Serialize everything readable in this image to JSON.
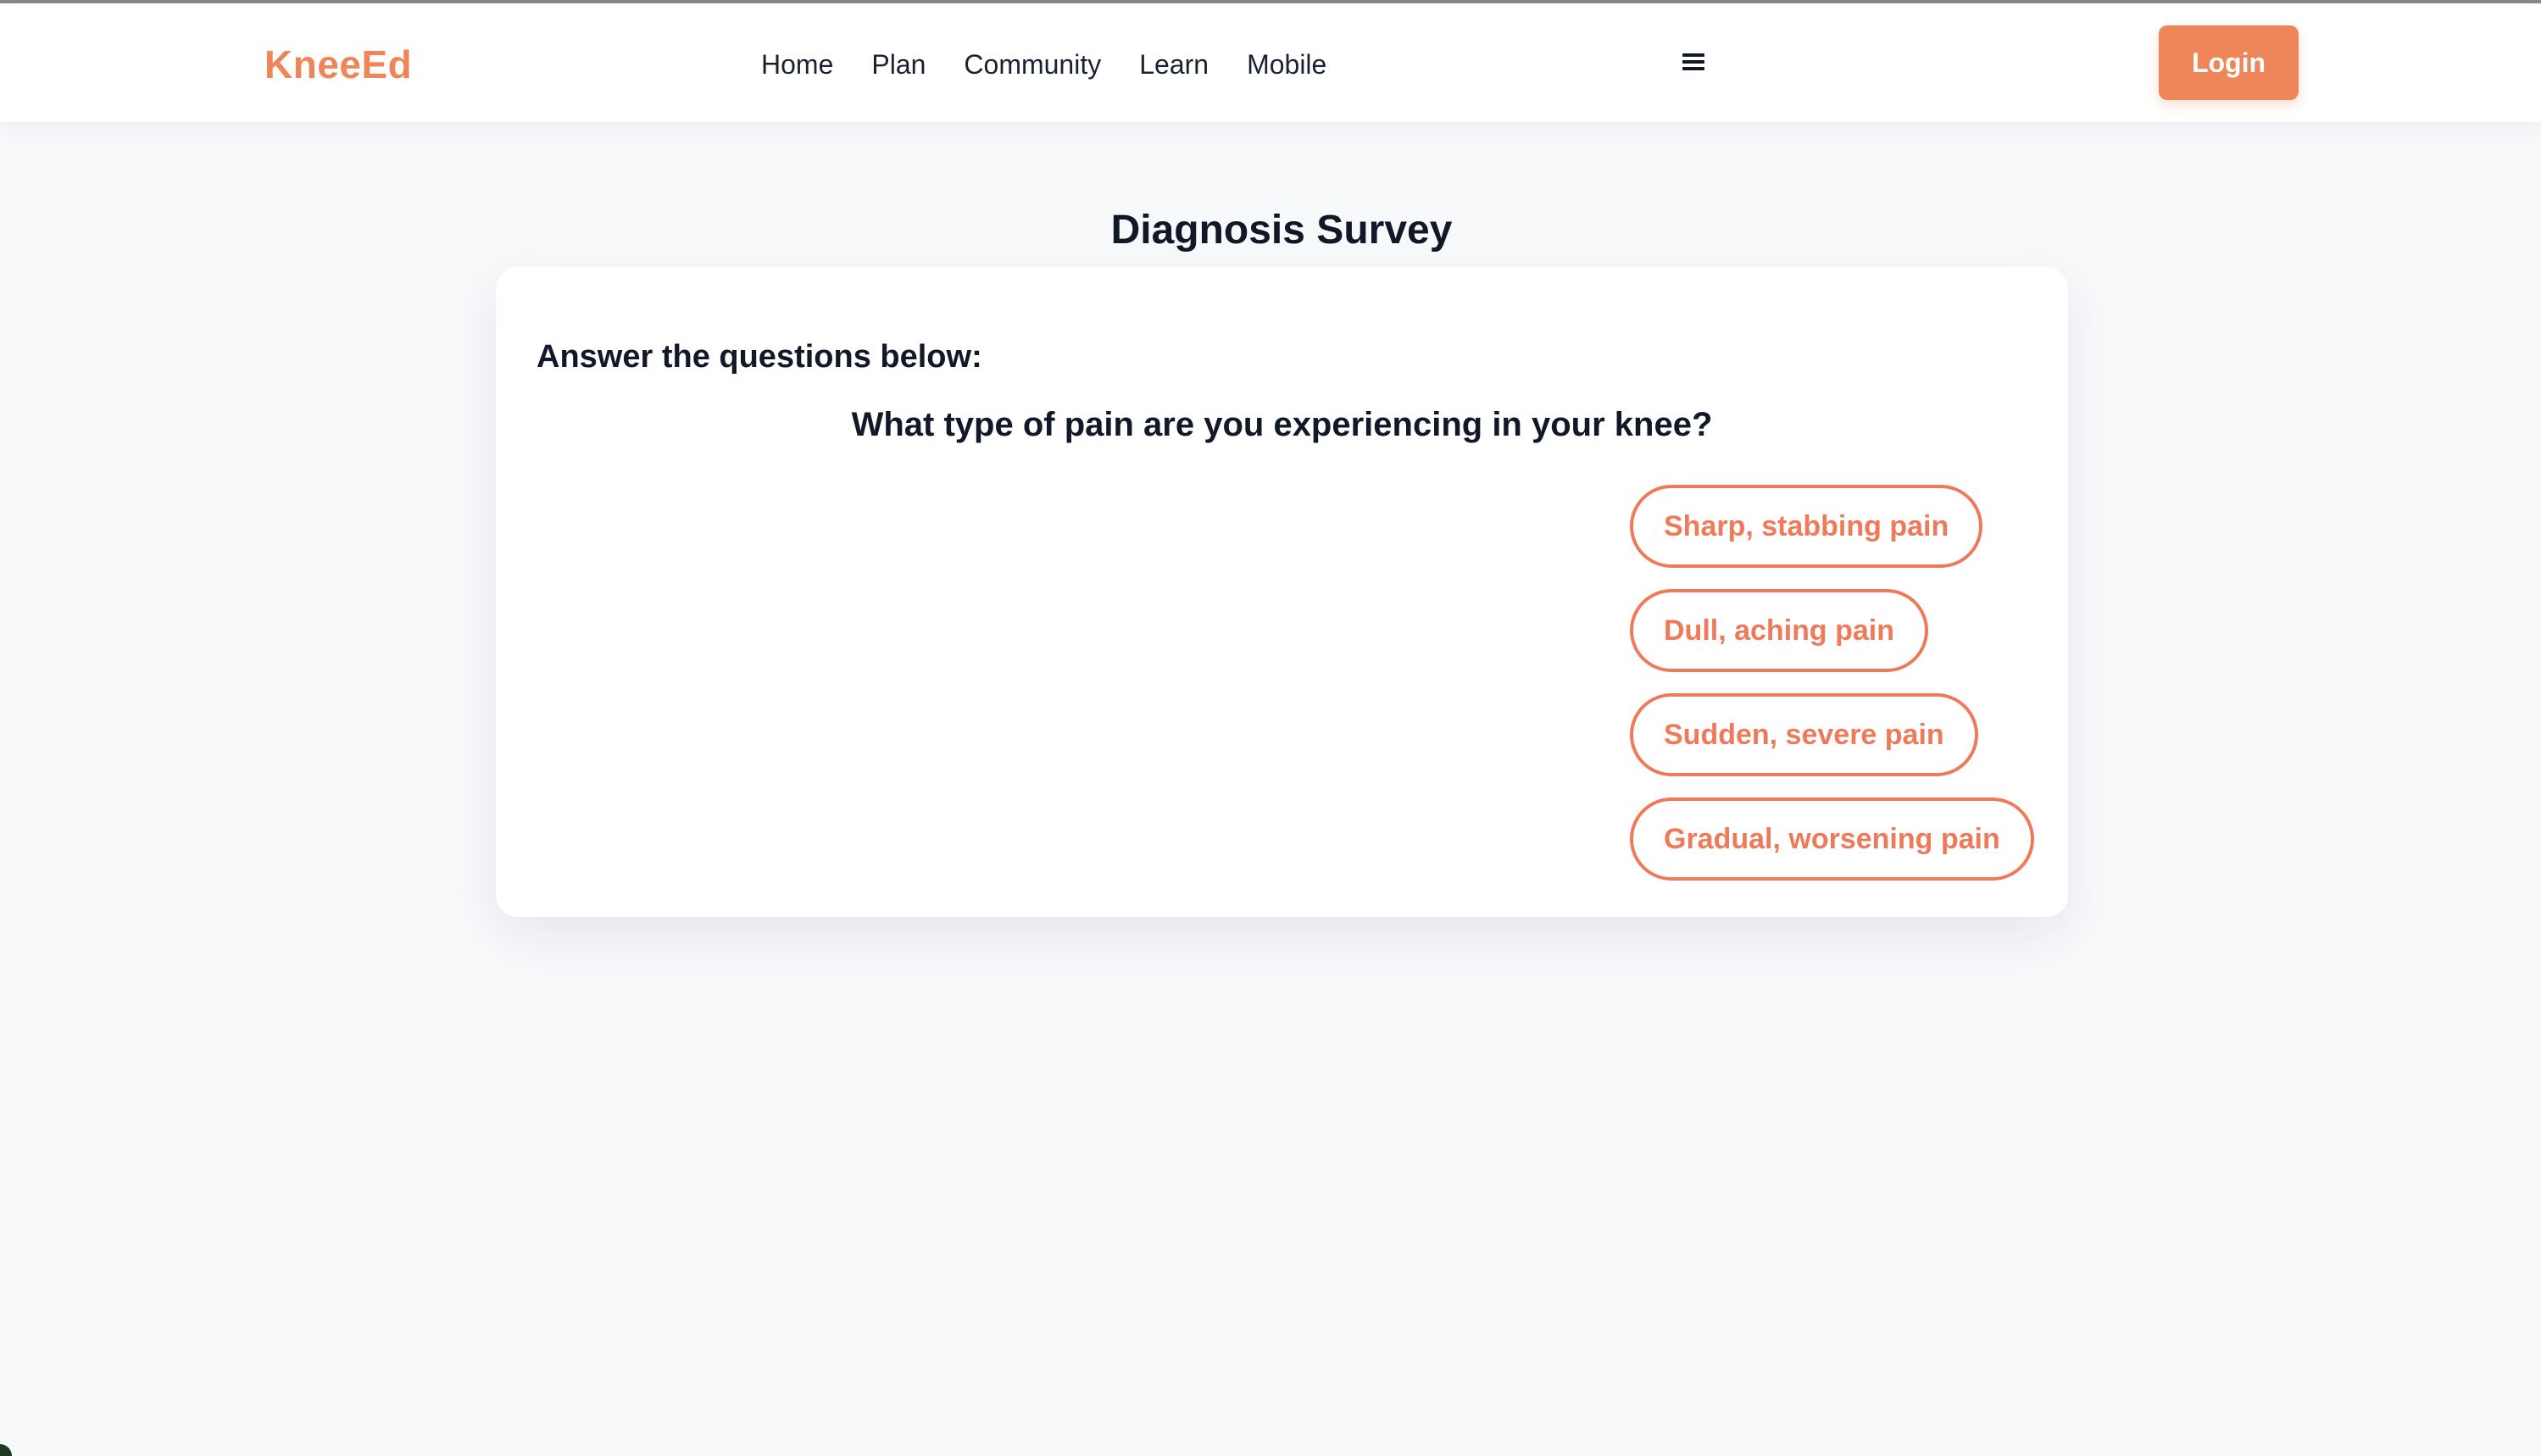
{
  "header": {
    "brand": "KneeEd",
    "nav_items": [
      "Home",
      "Plan",
      "Community",
      "Learn",
      "Mobile"
    ],
    "menu_icon": "hamburger-menu-icon",
    "login_label": "Login"
  },
  "main": {
    "title": "Diagnosis Survey",
    "instruction": "Answer the questions below:",
    "question": "What type of pain are you experiencing in your knee?",
    "options": [
      "Sharp, stabbing pain",
      "Dull, aching pain",
      "Sudden, severe pain",
      "Gradual, worsening pain"
    ]
  },
  "colors": {
    "accent": "#ef8659",
    "option_border": "#ef7a5a",
    "text": "#111827",
    "background": "#f8f9fb",
    "card": "#ffffff"
  }
}
